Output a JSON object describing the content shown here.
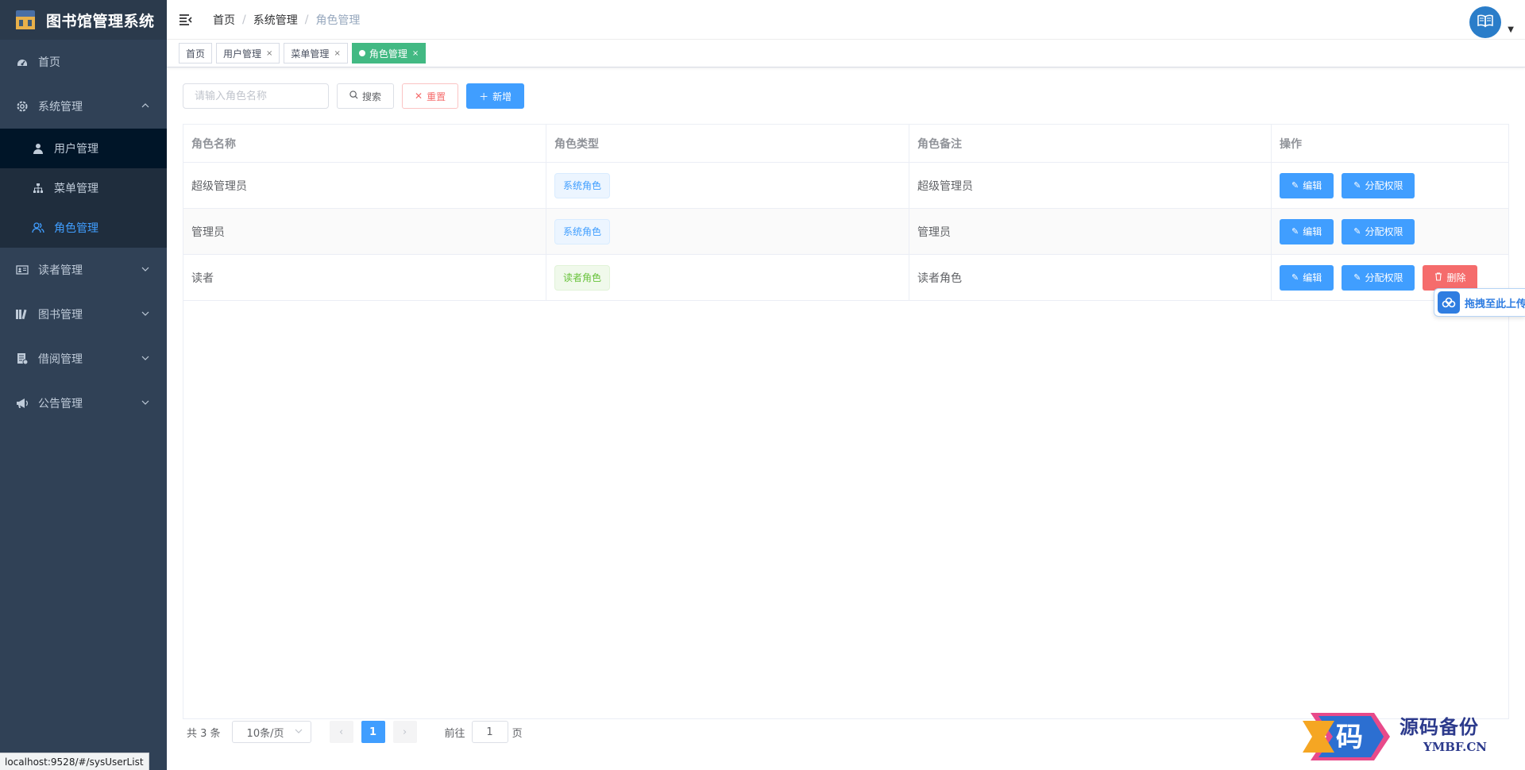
{
  "app": {
    "title": "图书馆管理系统"
  },
  "sidebar": {
    "items": [
      {
        "label": "首页",
        "icon": "dashboard-icon"
      },
      {
        "label": "系统管理",
        "icon": "gear-icon",
        "expanded": true,
        "children": [
          {
            "label": "用户管理",
            "icon": "user-icon"
          },
          {
            "label": "菜单管理",
            "icon": "tree-icon"
          },
          {
            "label": "角色管理",
            "icon": "peoples-icon",
            "active": true
          }
        ]
      },
      {
        "label": "读者管理",
        "icon": "id-card-icon"
      },
      {
        "label": "图书管理",
        "icon": "books-icon"
      },
      {
        "label": "借阅管理",
        "icon": "document-icon"
      },
      {
        "label": "公告管理",
        "icon": "megaphone-icon"
      }
    ]
  },
  "header": {
    "breadcrumb": [
      "首页",
      "系统管理",
      "角色管理"
    ]
  },
  "tags": [
    {
      "label": "首页",
      "closable": false,
      "active": false
    },
    {
      "label": "用户管理",
      "closable": true,
      "active": false
    },
    {
      "label": "菜单管理",
      "closable": true,
      "active": false
    },
    {
      "label": "角色管理",
      "closable": true,
      "active": true
    }
  ],
  "toolbar": {
    "search_placeholder": "请输入角色名称",
    "search_label": "搜索",
    "reset_label": "重置",
    "add_label": "新增"
  },
  "table": {
    "columns": [
      "角色名称",
      "角色类型",
      "角色备注",
      "操作"
    ],
    "rows": [
      {
        "name": "超级管理员",
        "type": "系统角色",
        "type_style": "system",
        "remark": "超级管理员",
        "actions": [
          "编辑",
          "分配权限"
        ]
      },
      {
        "name": "管理员",
        "type": "系统角色",
        "type_style": "system",
        "remark": "管理员",
        "actions": [
          "编辑",
          "分配权限"
        ]
      },
      {
        "name": "读者",
        "type": "读者角色",
        "type_style": "reader",
        "remark": "读者角色",
        "actions": [
          "编辑",
          "分配权限",
          "删除"
        ]
      }
    ]
  },
  "pagination": {
    "total": "共 3 条",
    "page_size": "10条/页",
    "current_page": "1",
    "goto_label": "前往",
    "goto_value": "1",
    "page_suffix": "页"
  },
  "float_upload": {
    "label": "拖拽至此上传"
  },
  "status_url": "localhost:9528/#/sysUserList",
  "watermark": {
    "text": "源码备份",
    "sub": "YMBF.CN",
    "glyph": "码"
  },
  "colors": {
    "sidebar_bg": "#304156",
    "primary": "#409eff",
    "danger": "#f56c6c",
    "success_tag": "#42b983"
  }
}
